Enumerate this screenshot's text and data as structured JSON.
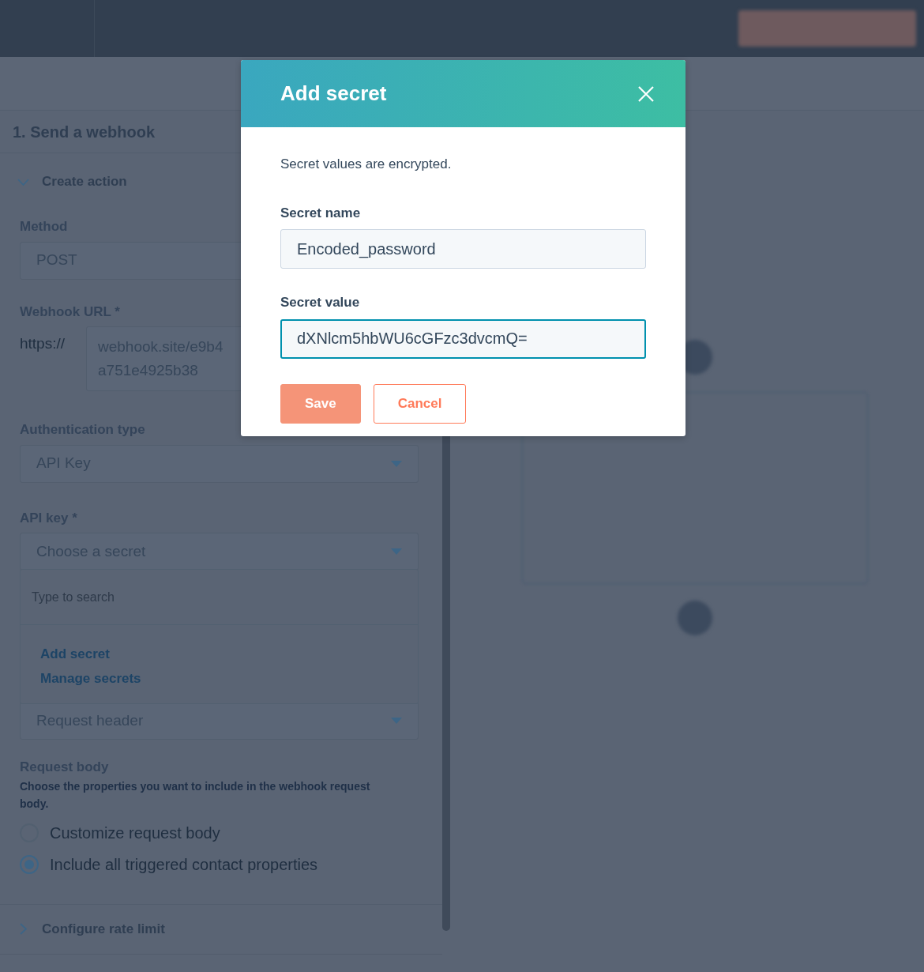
{
  "panel": {
    "title": "1. Send a webhook",
    "sections": [
      {
        "label": "Create action",
        "expanded": true
      }
    ],
    "method": {
      "label": "Method",
      "value": "POST"
    },
    "webhook_url": {
      "label": "Webhook URL *",
      "prefix": "https://",
      "lines": [
        "webhook.site/e9b4",
        "a751e4925b38"
      ]
    },
    "auth_type": {
      "label": "Authentication type",
      "value": "API Key"
    },
    "api_key": {
      "label": "API key *",
      "placeholder": "Choose a secret"
    },
    "dropdown": {
      "search_placeholder": "Type to search",
      "actions": [
        "Add secret",
        "Manage secrets"
      ]
    },
    "header_select": {
      "value": "Request header"
    },
    "request_body": {
      "label": "Request body",
      "help": "Choose the properties you want to include in the webhook request body.",
      "options": [
        {
          "label": "Customize request body",
          "selected": false
        },
        {
          "label": "Include all triggered contact properties",
          "selected": true
        }
      ]
    },
    "footer_section": {
      "label": "Configure rate limit",
      "expanded": false
    }
  },
  "modal": {
    "title": "Add secret",
    "description": "Secret values are encrypted.",
    "fields": [
      {
        "label": "Secret name",
        "value": "Encoded_password",
        "focused": false
      },
      {
        "label": "Secret value",
        "value": "dXNlcm5hbWU6cGFzc3dvcmQ=",
        "focused": true
      }
    ],
    "buttons": [
      {
        "label": "Save",
        "kind": "primary"
      },
      {
        "label": "Cancel",
        "kind": "secondary"
      }
    ]
  }
}
